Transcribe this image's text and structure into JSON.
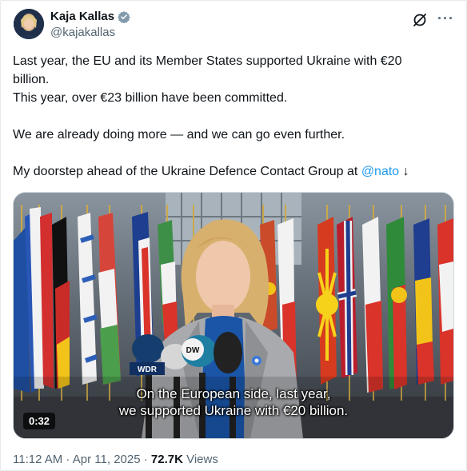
{
  "author": {
    "name": "Kaja Kallas",
    "handle": "@kajakallas",
    "verified_color": "#829aab"
  },
  "icons": [
    "grok-icon",
    "more-icon"
  ],
  "post": {
    "line1": "Last year, the EU and its Member States supported Ukraine with €20",
    "line2": "billion.",
    "line3": "This year, over €23 billion have been committed.",
    "line4": "We are already doing more — and we can go even further.",
    "line5_prefix": "My doorstep ahead of the Ukraine Defence Contact Group at ",
    "line5_mention": "@nato",
    "line5_suffix": " ↓"
  },
  "video": {
    "caption_line1": "On the European side, last year,",
    "caption_line2": "we supported Ukraine with €20 billion.",
    "duration": "0:32",
    "mic_label_dw": "DW",
    "mic_label_wdr": "WDR"
  },
  "meta": {
    "time": "11:12 AM",
    "separator": " · ",
    "date": "Apr 11, 2025",
    "views_count": "72.7K",
    "views_label": " Views"
  }
}
